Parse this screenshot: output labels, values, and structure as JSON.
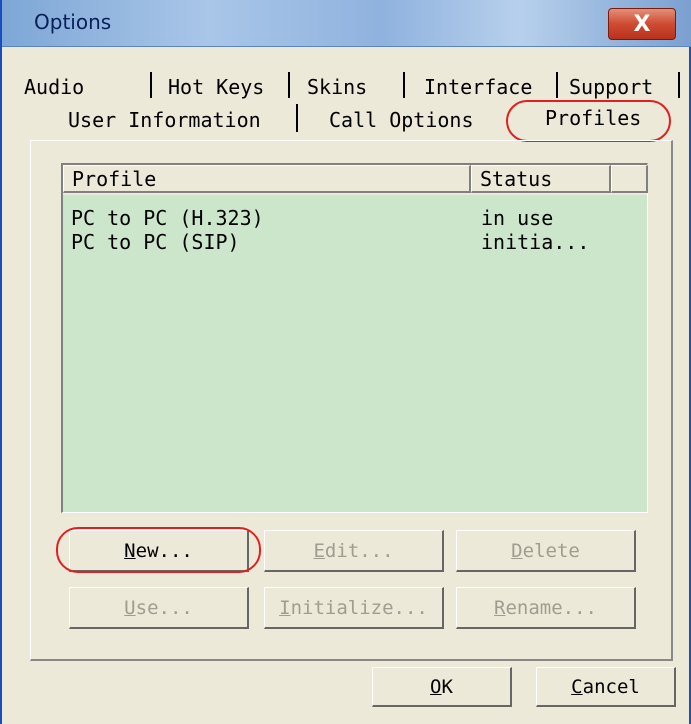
{
  "window": {
    "title": "Options",
    "close_glyph": "X"
  },
  "tabs_row1": [
    "Audio",
    "Hot Keys",
    "Skins",
    "Interface",
    "Support"
  ],
  "tabs_row2": [
    "User Information",
    "Call Options",
    "Profiles"
  ],
  "active_tab": "Profiles",
  "list": {
    "columns": [
      "Profile",
      "Status"
    ],
    "rows": [
      {
        "profile": "PC to PC (H.323)",
        "status": "in use"
      },
      {
        "profile": "PC to PC (SIP)",
        "status": "initia..."
      }
    ],
    "background": "#cce6cc"
  },
  "buttons": {
    "new": {
      "accel": "N",
      "rest": "ew..."
    },
    "edit": {
      "accel": "E",
      "rest": "dit..."
    },
    "delete": {
      "accel": "D",
      "rest": "elete"
    },
    "use": {
      "accel": "U",
      "rest": "se..."
    },
    "initialize": {
      "accel": "I",
      "rest": "nitialize..."
    },
    "rename": {
      "accel": "R",
      "rest": "ename..."
    },
    "ok": {
      "accel": "O",
      "rest": "K"
    },
    "cancel": {
      "accel": "C",
      "rest": "ancel"
    }
  },
  "colors": {
    "annotation": "#e02020",
    "close_button": "#cf4b32"
  }
}
